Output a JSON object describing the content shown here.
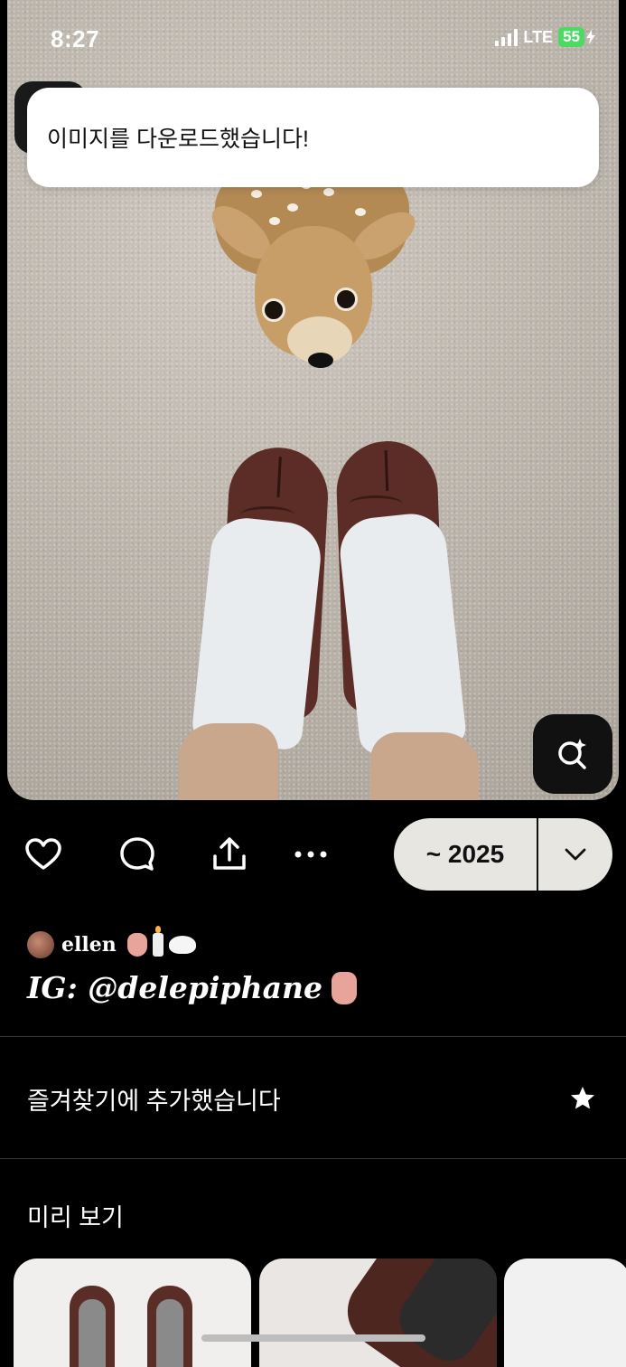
{
  "status_bar": {
    "time": "8:27",
    "network": "LTE",
    "battery": "55"
  },
  "toast": {
    "message": "이미지를 다운로드했습니다!"
  },
  "pin": {
    "lens_icon": "visual-search-sparkle-icon"
  },
  "actions": {
    "like_icon": "heart-icon",
    "comment_icon": "comment-bubble-icon",
    "share_icon": "share-upload-icon",
    "more_icon": "more-dots-icon",
    "board_label": "~ 2025",
    "board_chevron_icon": "chevron-down-icon"
  },
  "author": {
    "name": "ellen"
  },
  "caption": "IG: @delepiphane",
  "favorite": {
    "label": "즐겨찾기에 추가했습니다",
    "icon": "star-icon"
  },
  "preview": {
    "title": "미리 보기"
  },
  "colors": {
    "background": "#000000",
    "pill_bg": "#e8e6e1",
    "toast_bg": "#ffffff",
    "battery": "#4cd964"
  }
}
